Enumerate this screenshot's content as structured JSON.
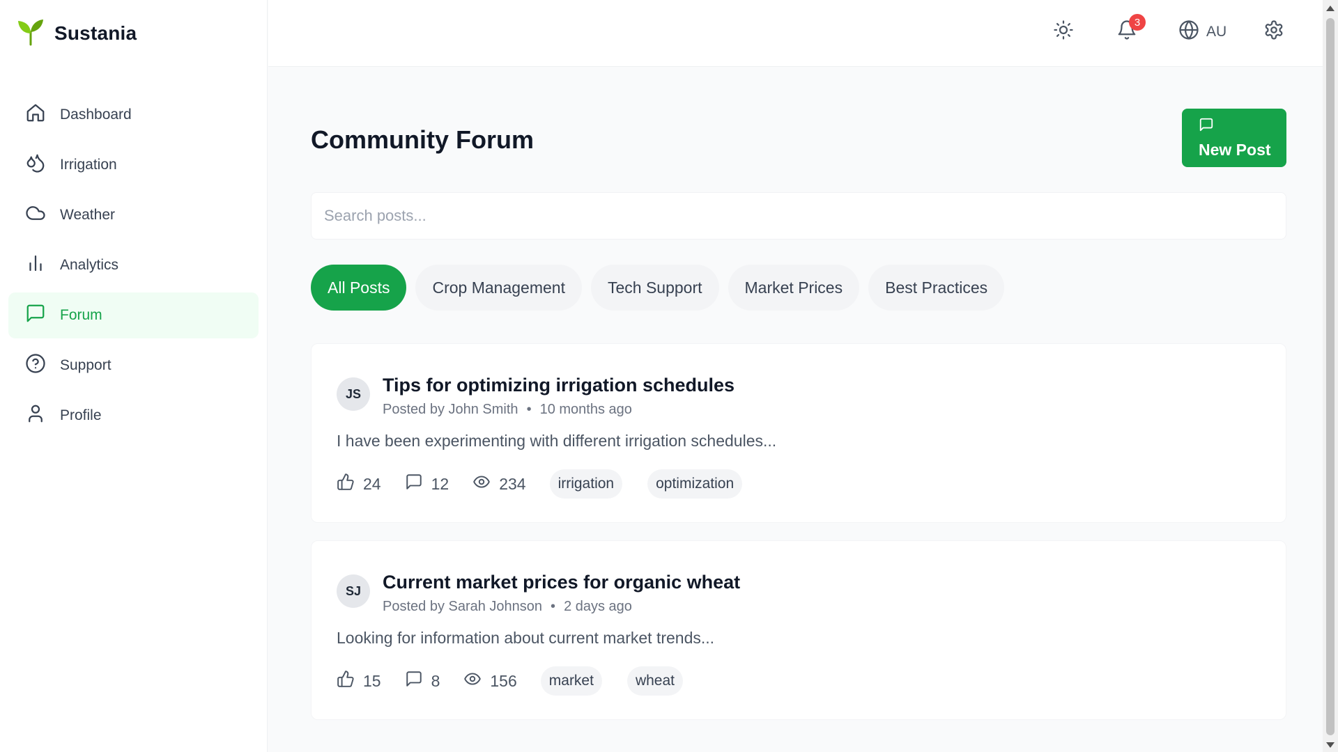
{
  "brand": {
    "name": "Sustania",
    "icon": "sprout-icon",
    "color": "#65a30d"
  },
  "sidebar": {
    "items": [
      {
        "label": "Dashboard",
        "icon": "home-icon",
        "active": false
      },
      {
        "label": "Irrigation",
        "icon": "droplets-icon",
        "active": false
      },
      {
        "label": "Weather",
        "icon": "cloud-icon",
        "active": false
      },
      {
        "label": "Analytics",
        "icon": "bar-chart-icon",
        "active": false
      },
      {
        "label": "Forum",
        "icon": "message-square-icon",
        "active": true
      },
      {
        "label": "Support",
        "icon": "help-circle-icon",
        "active": false
      },
      {
        "label": "Profile",
        "icon": "user-icon",
        "active": false
      }
    ]
  },
  "header": {
    "theme_icon": "sun-icon",
    "notifications": {
      "icon": "bell-icon",
      "count": "3"
    },
    "language": {
      "icon": "globe-icon",
      "code": "AU"
    },
    "settings_icon": "gear-icon"
  },
  "main": {
    "title": "Community Forum",
    "new_post_label": "New Post",
    "search_placeholder": "Search posts...",
    "filters": [
      {
        "label": "All Posts",
        "active": true
      },
      {
        "label": "Crop Management",
        "active": false
      },
      {
        "label": "Tech Support",
        "active": false
      },
      {
        "label": "Market Prices",
        "active": false
      },
      {
        "label": "Best Practices",
        "active": false
      }
    ],
    "posts": [
      {
        "initials": "JS",
        "title": "Tips for optimizing irrigation schedules",
        "author": "Posted by John Smith",
        "separator": "•",
        "time": "10 months ago",
        "excerpt": "I have been experimenting with different irrigation schedules...",
        "likes": "24",
        "comments": "12",
        "views": "234",
        "tags": [
          "irrigation",
          "optimization"
        ]
      },
      {
        "initials": "SJ",
        "title": "Current market prices for organic wheat",
        "author": "Posted by Sarah Johnson",
        "separator": "•",
        "time": "2 days ago",
        "excerpt": "Looking for information about current market trends...",
        "likes": "15",
        "comments": "8",
        "views": "156",
        "tags": [
          "market",
          "wheat"
        ]
      }
    ]
  },
  "colors": {
    "accent": "#16a34a",
    "accent_light": "#f0fdf4",
    "badge": "#ef4444"
  }
}
